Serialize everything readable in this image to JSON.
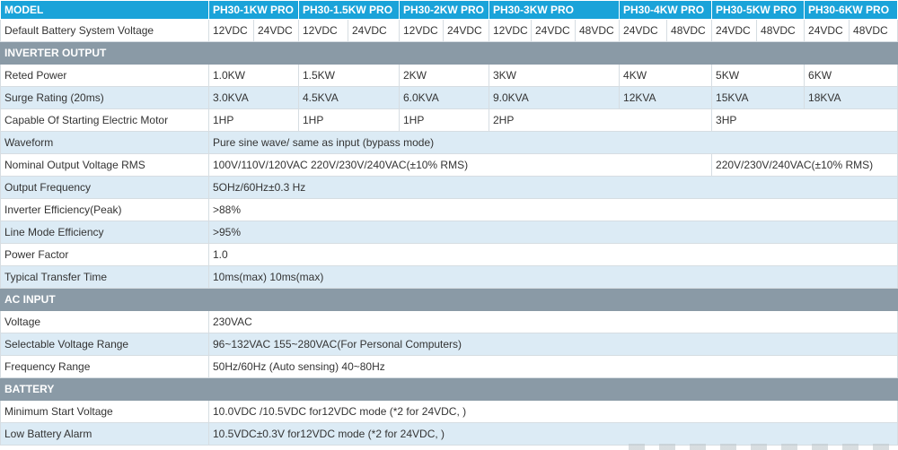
{
  "header": {
    "model_label": "MODEL",
    "models": [
      "PH30-1KW PRO",
      "PH30-1.5KW PRO",
      "PH30-2KW PRO",
      "PH30-3KW PRO",
      "PH30-4KW PRO",
      "PH30-5KW PRO",
      "PH30-6KW PRO"
    ]
  },
  "battery_voltage": {
    "label": "Default Battery System Voltage",
    "values": [
      "12VDC",
      "24VDC",
      "12VDC",
      "24VDC",
      "12VDC",
      "24VDC",
      "12VDC",
      "24VDC",
      "48VDC",
      "24VDC",
      "48VDC",
      "24VDC",
      "48VDC",
      "24VDC",
      "48VDC"
    ]
  },
  "inverter": {
    "title": "INVERTER OUTPUT",
    "rated_power": {
      "label": "Reted Power",
      "values": [
        "1.0KW",
        "1.5KW",
        "2KW",
        "3KW",
        "4KW",
        "5KW",
        "6KW"
      ]
    },
    "surge": {
      "label": "Surge Rating (20ms)",
      "values": [
        "3.0KVA",
        "4.5KVA",
        "6.0KVA",
        "9.0KVA",
        "12KVA",
        "15KVA",
        "18KVA"
      ]
    },
    "motor": {
      "label": "Capable Of Starting Electric Motor",
      "values": [
        "1HP",
        "1HP",
        "1HP",
        "2HP",
        "3HP"
      ]
    },
    "waveform": {
      "label": "Waveform",
      "value": "Pure sine wave/ same as input (bypass mode)"
    },
    "nominal_voltage": {
      "label": "Nominal Output Voltage RMS",
      "value_a": "100V/110V/120VAC  220V/230V/240VAC(±10% RMS)",
      "value_b": "220V/230V/240VAC(±10% RMS)"
    },
    "frequency": {
      "label": "Output Frequency",
      "value": "5OHz/60Hz±0.3 Hz"
    },
    "efficiency": {
      "label": "Inverter Efficiency(Peak)",
      "value": ">88%"
    },
    "line_mode": {
      "label": "Line Mode Efficiency",
      "value": ">95%"
    },
    "power_factor": {
      "label": "Power Factor",
      "value": "1.0"
    },
    "transfer_time": {
      "label": "Typical Transfer Time",
      "value": "10ms(max) 10ms(max)"
    }
  },
  "ac_input": {
    "title": "AC INPUT",
    "voltage": {
      "label": "Voltage",
      "value": "230VAC"
    },
    "selectable_range": {
      "label": "Selectable Voltage Range",
      "value": "96~132VAC  155~280VAC(For Personal Computers)"
    },
    "frequency_range": {
      "label": "Frequency Range",
      "value": "50Hz/60Hz (Auto sensing) 40~80Hz"
    }
  },
  "battery": {
    "title": "BATTERY",
    "min_start": {
      "label": "Minimum Start Voltage",
      "value": "10.0VDC /10.5VDC for12VDC mode (*2 for 24VDC, )"
    },
    "low_alarm": {
      "label": "Low Battery Alarm",
      "value": "10.5VDC±0.3V for12VDC mode (*2 for 24VDC, )"
    }
  }
}
